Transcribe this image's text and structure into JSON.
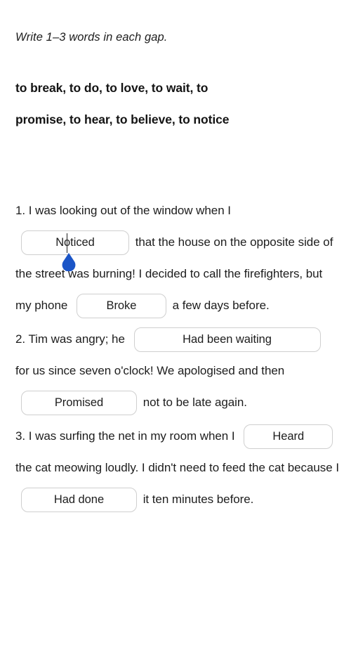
{
  "instruction": "Write 1–3 words in each gap.",
  "word_bank": {
    "line1": "to break, to do, to love, to wait, to",
    "line2": "promise, to hear, to believe, to notice"
  },
  "colors": {
    "page_background": "#ffffff",
    "text": "#1d1d1d",
    "heading_text": "#141414",
    "input_border": "#cfcfcf",
    "input_background": "#ffffff",
    "selection_handle": "#1b55c7",
    "caret": "#202020"
  },
  "questions": [
    {
      "number": "1.",
      "segments": [
        {
          "type": "text",
          "value": "1. I was looking out of the window when I "
        },
        {
          "type": "gap",
          "value": "Noticed",
          "name": "gap-1a",
          "focused": true
        },
        {
          "type": "text",
          "value": " that the house on the opposite side of the street was burning! I decided to call the firefighters, but my phone "
        },
        {
          "type": "gap",
          "value": "Broke",
          "name": "gap-1b",
          "focused": false
        },
        {
          "type": "text",
          "value": " a few days before."
        }
      ]
    },
    {
      "number": "2.",
      "segments": [
        {
          "type": "text",
          "value": "2. Tim was angry; he "
        },
        {
          "type": "gap",
          "value": "Had been waiting",
          "name": "gap-2a",
          "focused": false
        },
        {
          "type": "text",
          "value": " for us since seven o'clock! We apologised and then "
        },
        {
          "type": "gap",
          "value": "Promised",
          "name": "gap-2b",
          "focused": false
        },
        {
          "type": "text",
          "value": " not to be late again."
        }
      ]
    },
    {
      "number": "3.",
      "segments": [
        {
          "type": "text",
          "value": "3. I was surfing the net in my room when I "
        },
        {
          "type": "gap",
          "value": "Heard",
          "name": "gap-3a",
          "focused": false
        },
        {
          "type": "text",
          "value": " the cat meowing loudly. I didn't need to feed the cat because I "
        },
        {
          "type": "gap",
          "value": "Had done",
          "name": "gap-3b",
          "focused": false
        },
        {
          "type": "text",
          "value": " it ten minutes before."
        }
      ]
    }
  ],
  "q1": {
    "part1": "1. I was looking out of the window when I",
    "gap1": "Noticed",
    "part2": "that the house on the",
    "part3": "opposite side of the street was burning! I",
    "part4": "decided to call the firefighters, but my phone",
    "gap2": "Broke",
    "part5": "a few days before."
  },
  "q2": {
    "part1": "2. Tim was angry; he",
    "gap1": "Had been waiting",
    "part2": "for us since",
    "part3": "seven o'clock! We apologised and then",
    "gap2": "Promised",
    "part4": "not to be late again."
  },
  "q3": {
    "part1": "3. I was surfing the net in my room when I",
    "gap1": "Heard",
    "part2": "the cat meowing loudly. I",
    "part3": "didn't need to feed the cat because I",
    "gap2": "Had done",
    "part4": "it ten minutes before."
  }
}
